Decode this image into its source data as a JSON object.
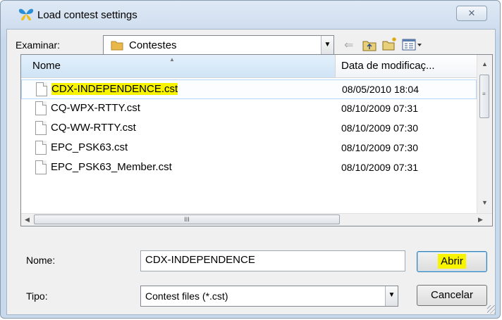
{
  "window": {
    "title": "Load contest settings",
    "close_icon": "close-icon",
    "close_glyph": "✕"
  },
  "location": {
    "label": "Examinar:",
    "value": "Contestes",
    "icons": [
      "back-arrow-icon",
      "up-folder-icon",
      "new-folder-icon",
      "views-menu-icon"
    ]
  },
  "file_list": {
    "columns": [
      "Nome",
      "Data de modificaç..."
    ],
    "rows": [
      {
        "name": "CDX-INDEPENDENCE.cst",
        "date": "08/05/2010 18:04",
        "selected": true
      },
      {
        "name": "CQ-WPX-RTTY.cst",
        "date": "08/10/2009 07:31",
        "selected": false
      },
      {
        "name": "CQ-WW-RTTY.cst",
        "date": "08/10/2009 07:30",
        "selected": false
      },
      {
        "name": "EPC_PSK63.cst",
        "date": "08/10/2009 07:30",
        "selected": false
      },
      {
        "name": "EPC_PSK63_Member.cst",
        "date": "08/10/2009 07:31",
        "selected": false
      }
    ],
    "scroll_grip": "III"
  },
  "filename": {
    "label": "Nome:",
    "value": "CDX-INDEPENDENCE"
  },
  "filetype": {
    "label": "Tipo:",
    "value": "Contest files (*.cst)"
  },
  "buttons": {
    "open": "Abrir",
    "cancel": "Cancelar"
  },
  "colors": {
    "highlight": "#f8f400",
    "dialog_bg": "#f0f0f0",
    "frame": "#c9d9ec"
  }
}
